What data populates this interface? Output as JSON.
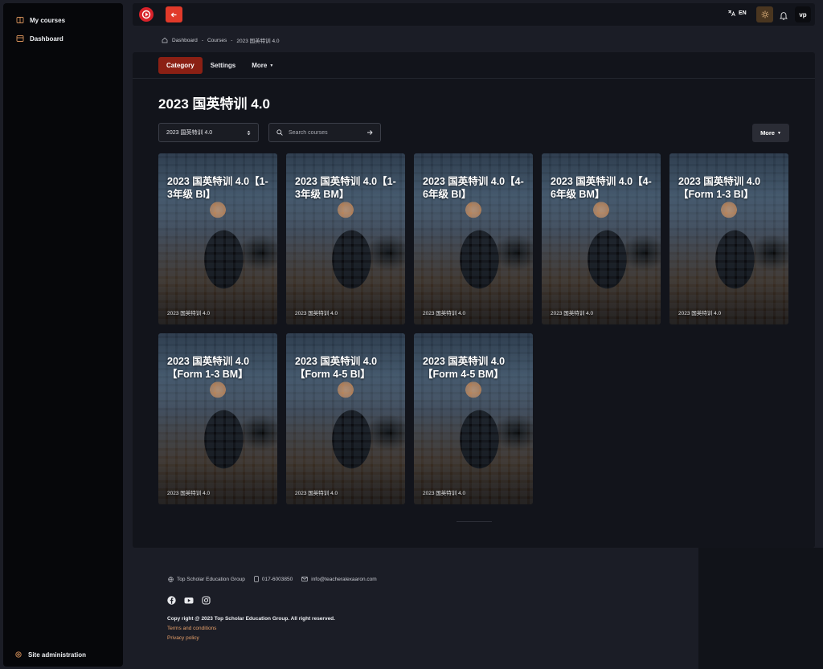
{
  "sidebar": {
    "items": [
      {
        "label": "My courses",
        "icon": "book-icon"
      },
      {
        "label": "Dashboard",
        "icon": "calendar-icon"
      }
    ],
    "admin_label": "Site administration"
  },
  "topbar": {
    "lang": "EN",
    "avatar": "vp"
  },
  "breadcrumb": [
    "Dashboard",
    "Courses",
    "2023 国英特训 4.0"
  ],
  "tabs": {
    "category": "Category",
    "settings": "Settings",
    "more": "More"
  },
  "page": {
    "title": "2023 国英特训 4.0",
    "category_select": "2023 国英特训 4.0",
    "search_placeholder": "Search courses",
    "more_label": "More"
  },
  "courses": [
    {
      "title": "2023 国英特训 4.0【1-3年级 BI】",
      "category": "2023 国英特训 4.0"
    },
    {
      "title": "2023 国英特训 4.0【1-3年级 BM】",
      "category": "2023 国英特训 4.0"
    },
    {
      "title": "2023 国英特训 4.0【4-6年级 BI】",
      "category": "2023 国英特训 4.0"
    },
    {
      "title": "2023 国英特训 4.0【4-6年级 BM】",
      "category": "2023 国英特训 4.0"
    },
    {
      "title": "2023 国英特训 4.0【Form 1-3 BI】",
      "category": "2023 国英特训 4.0"
    },
    {
      "title": "2023 国英特训 4.0【Form 1-3 BM】",
      "category": "2023 国英特训 4.0"
    },
    {
      "title": "2023 国英特训 4.0【Form 4-5 BI】",
      "category": "2023 国英特训 4.0"
    },
    {
      "title": "2023 国英特训 4.0【Form 4-5 BM】",
      "category": "2023 国英特训 4.0"
    }
  ],
  "footer": {
    "company": "Top Scholar Education Group",
    "phone": "017-6003850",
    "email": "info@teacheralexaaron.com",
    "copyright": "Copy right @ 2023 Top Scholar Education Group. All right reserved.",
    "terms": "Terms and conditions",
    "privacy": "Privacy policy"
  },
  "colors": {
    "accent": "#e13a2a",
    "tab_active": "#8b2014",
    "link": "#e7a06a"
  }
}
